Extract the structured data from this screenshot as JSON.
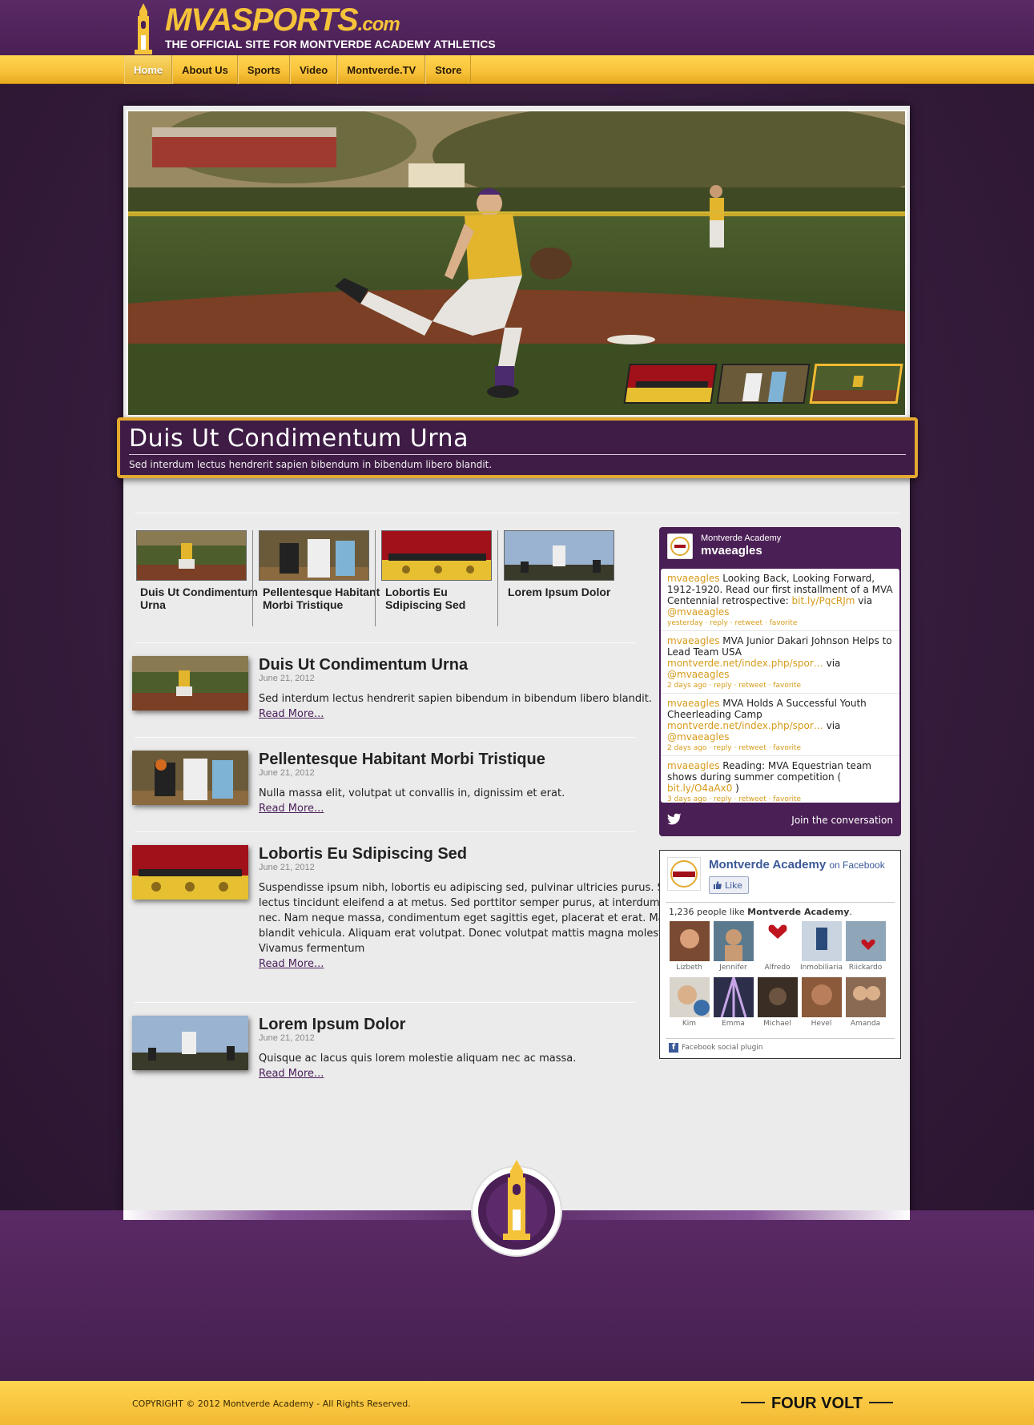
{
  "header": {
    "logo_main": "MVASPORTS",
    "logo_domain": ".com",
    "tagline": "THE OFFICIAL SITE FOR MONTVERDE ACADEMY ATHLETICS"
  },
  "nav": {
    "items": [
      {
        "label": "Home",
        "active": true
      },
      {
        "label": "About Us"
      },
      {
        "label": "Sports"
      },
      {
        "label": "Video"
      },
      {
        "label": "Montverde.TV"
      },
      {
        "label": "Store"
      }
    ]
  },
  "slider": {
    "title": "Duis Ut Condimentum Urna",
    "subtitle": "Sed interdum lectus hendrerit sapien bibendum in bibendum libero blandit.",
    "thumbs": [
      "stage",
      "basketball",
      "baseball"
    ],
    "active_thumb": 3
  },
  "featured": [
    {
      "title": "Duis Ut Condimentum Urna"
    },
    {
      "title": "Pellentesque Habitant Morbi Tristique"
    },
    {
      "title": "Lobortis Eu Sdipiscing Sed"
    },
    {
      "title": "Lorem Ipsum Dolor"
    }
  ],
  "articles": [
    {
      "title": "Duis Ut Condimentum Urna",
      "date": "June 21, 2012",
      "text": "Sed interdum lectus hendrerit sapien bibendum in bibendum libero blandit.",
      "more": "Read More..."
    },
    {
      "title": "Pellentesque Habitant Morbi Tristique",
      "date": "June 21, 2012",
      "text": "Nulla massa elit, volutpat ut convallis in, dignissim et erat.",
      "more": "Read More..."
    },
    {
      "title": "Lobortis Eu Sdipiscing Sed",
      "date": "June 21, 2012",
      "text": "Suspendisse ipsum nibh, lobortis eu adipiscing sed, pulvinar ultricies purus. Sed et risus sit amet lectus tincidunt eleifend a at metus. Sed porttitor semper purus, at interdum magna venenatis nec. Nam neque massa, condimentum eget sagittis eget, placerat et erat. Maecenas ornare blandit vehicula. Aliquam erat volutpat. Donec volutpat mattis magna molestie imperdiet. Vivamus fermentum",
      "more": "Read More..."
    },
    {
      "title": "Lorem Ipsum Dolor",
      "date": "June 21, 2012",
      "text": "Quisque ac lacus quis lorem molestie aliquam nec ac massa.",
      "more": "Read More..."
    }
  ],
  "twitter": {
    "name": "Montverde Academy",
    "handle": "mvaeagles",
    "tweets": [
      {
        "user": "mvaeagles",
        "pre": " Looking Back, Looking Forward, 1912-1920. Read our first installment of a MVA Centennial retrospective: ",
        "link": "bit.ly/PqcRJm",
        "post": " via ",
        "via": "@mvaeagles",
        "time": "yesterday",
        "actions": "· reply · retweet · favorite"
      },
      {
        "user": "mvaeagles",
        "pre": " MVA Junior Dakari Johnson Helps to Lead Team USA ",
        "link": "montverde.net/index.php/spor…",
        "post": " via ",
        "via": "@mvaeagles",
        "time": "2 days ago",
        "actions": "· reply · retweet · favorite"
      },
      {
        "user": "mvaeagles",
        "pre": " MVA Holds A Successful Youth Cheerleading Camp ",
        "link": "montverde.net/index.php/spor…",
        "post": " via ",
        "via": "@mvaeagles",
        "time": "2 days ago",
        "actions": "· reply · retweet · favorite"
      },
      {
        "user": "mvaeagles",
        "pre": " Reading: MVA Equestrian team shows during summer competition ( ",
        "link": "bit.ly/O4aAx0",
        "post": " )",
        "via": "",
        "time": "3 days ago",
        "actions": "· reply · retweet · favorite"
      }
    ],
    "join": "Join the conversation"
  },
  "facebook": {
    "page": "Montverde Academy",
    "on": "on Facebook",
    "like": "Like",
    "count_prefix": "1,236 people like ",
    "count_page": "Montverde Academy",
    "count_suffix": ".",
    "faces": [
      {
        "name": "Lizbeth",
        "color": "#7a4a32"
      },
      {
        "name": "Jennifer",
        "color": "#5b7a8e"
      },
      {
        "name": "Alfredo",
        "color": "#ffffff"
      },
      {
        "name": "Inmobiliaria",
        "color": "#c9d4e0"
      },
      {
        "name": "Riickardo",
        "color": "#8fa6b8"
      },
      {
        "name": "Kim",
        "color": "#d9d4cc"
      },
      {
        "name": "Emma",
        "color": "#2d2f4a"
      },
      {
        "name": "Michael",
        "color": "#3a2e24"
      },
      {
        "name": "Hevel",
        "color": "#8a5a3a"
      },
      {
        "name": "Amanda",
        "color": "#8a6a52"
      }
    ],
    "plugin": "Facebook social plugin"
  },
  "footer": {
    "copyright": "COPYRIGHT © 2012 Montverde Academy - All Rights Reserved.",
    "credit": "FOUR VOLT"
  },
  "colors": {
    "purple": "#4a1f55",
    "gold": "#f3b933",
    "link": "#d69b1a"
  }
}
